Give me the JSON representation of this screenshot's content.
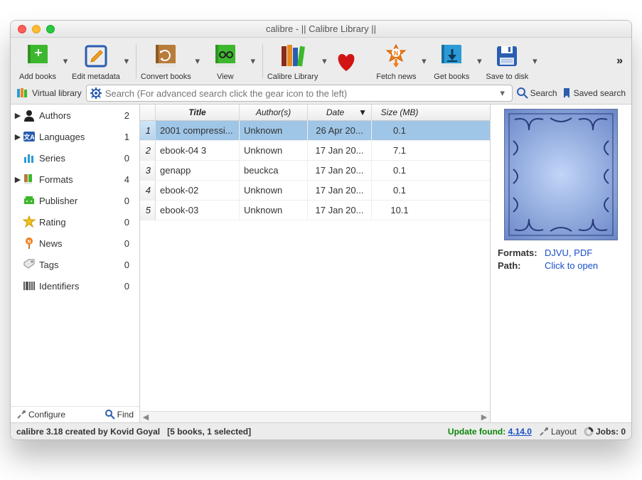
{
  "window": {
    "title": "calibre - || Calibre Library ||"
  },
  "toolbar": {
    "add_books": "Add books",
    "edit_metadata": "Edit metadata",
    "convert_books": "Convert books",
    "view": "View",
    "calibre_library": "Calibre Library",
    "fetch_news": "Fetch news",
    "get_books": "Get books",
    "save_to_disk": "Save to disk"
  },
  "searchbar": {
    "virtual_library": "Virtual library",
    "placeholder": "Search (For advanced search click the gear icon to the left)",
    "search_label": "Search",
    "saved_search": "Saved search"
  },
  "sidebar": {
    "items": [
      {
        "label": "Authors",
        "count": "2",
        "expandable": true
      },
      {
        "label": "Languages",
        "count": "1",
        "expandable": true
      },
      {
        "label": "Series",
        "count": "0",
        "expandable": false
      },
      {
        "label": "Formats",
        "count": "4",
        "expandable": true
      },
      {
        "label": "Publisher",
        "count": "0",
        "expandable": false
      },
      {
        "label": "Rating",
        "count": "0",
        "expandable": false
      },
      {
        "label": "News",
        "count": "0",
        "expandable": false
      },
      {
        "label": "Tags",
        "count": "0",
        "expandable": false
      },
      {
        "label": "Identifiers",
        "count": "0",
        "expandable": false
      }
    ],
    "configure": "Configure",
    "find": "Find"
  },
  "table": {
    "columns": {
      "title": "Title",
      "authors": "Author(s)",
      "date": "Date",
      "size": "Size (MB)"
    },
    "rows": [
      {
        "idx": "1",
        "title": "2001 compressi...",
        "authors": "Unknown",
        "date": "26 Apr 20...",
        "size": "0.1",
        "selected": true
      },
      {
        "idx": "2",
        "title": "ebook-04 3",
        "authors": "Unknown",
        "date": "17 Jan 20...",
        "size": "7.1",
        "selected": false
      },
      {
        "idx": "3",
        "title": "genapp",
        "authors": "beuckca",
        "date": "17 Jan 20...",
        "size": "0.1",
        "selected": false
      },
      {
        "idx": "4",
        "title": "ebook-02",
        "authors": "Unknown",
        "date": "17 Jan 20...",
        "size": "0.1",
        "selected": false
      },
      {
        "idx": "5",
        "title": "ebook-03",
        "authors": "Unknown",
        "date": "17 Jan 20...",
        "size": "10.1",
        "selected": false
      }
    ]
  },
  "details": {
    "formats_label": "Formats:",
    "formats_value": "DJVU, PDF",
    "path_label": "Path:",
    "path_value": "Click to open"
  },
  "status": {
    "app_info": "calibre 3.18 created by Kovid Goyal",
    "selection": "[5 books, 1 selected]",
    "update_prefix": "Update found: ",
    "update_version": "4.14.0",
    "layout": "Layout",
    "jobs": "Jobs: 0"
  }
}
